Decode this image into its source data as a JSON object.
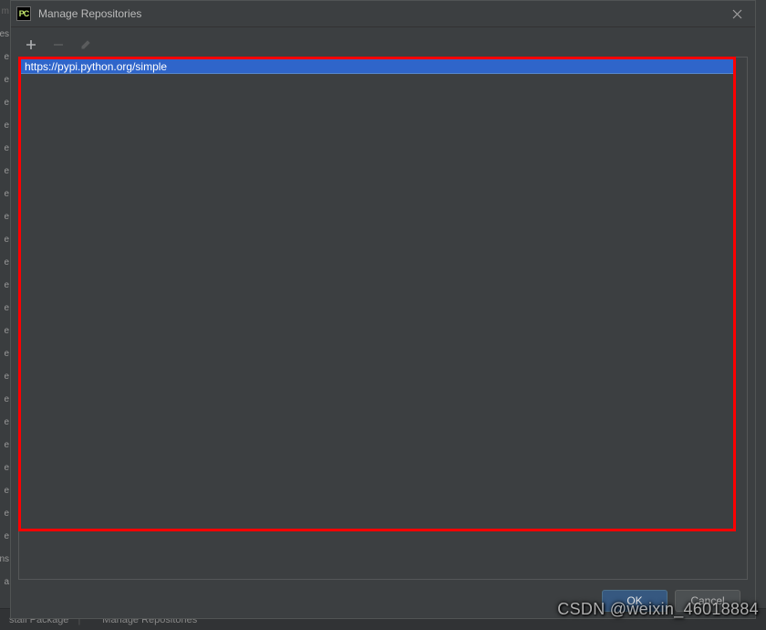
{
  "dialog": {
    "title": "Manage Repositories",
    "app_icon_label": "PC"
  },
  "toolbar": {
    "add_name": "add",
    "remove_name": "remove",
    "edit_name": "edit"
  },
  "repositories": {
    "items": [
      {
        "url": "https://pypi.python.org/simple"
      }
    ]
  },
  "buttons": {
    "ok": "OK",
    "cancel": "Cancel"
  },
  "background": {
    "left_items": [
      "m",
      "es",
      "e",
      "e",
      "e",
      "e",
      "e",
      "e",
      "e",
      "e",
      "e",
      "e",
      "e",
      "e",
      "e",
      "e",
      "e",
      "e",
      "e",
      "e",
      "e",
      "e",
      "e",
      "e",
      "ns",
      "a"
    ],
    "bottom": {
      "install_label": "stall Package",
      "manage_label": "Manage Repositories"
    }
  },
  "watermark": "CSDN @weixin_46018884"
}
